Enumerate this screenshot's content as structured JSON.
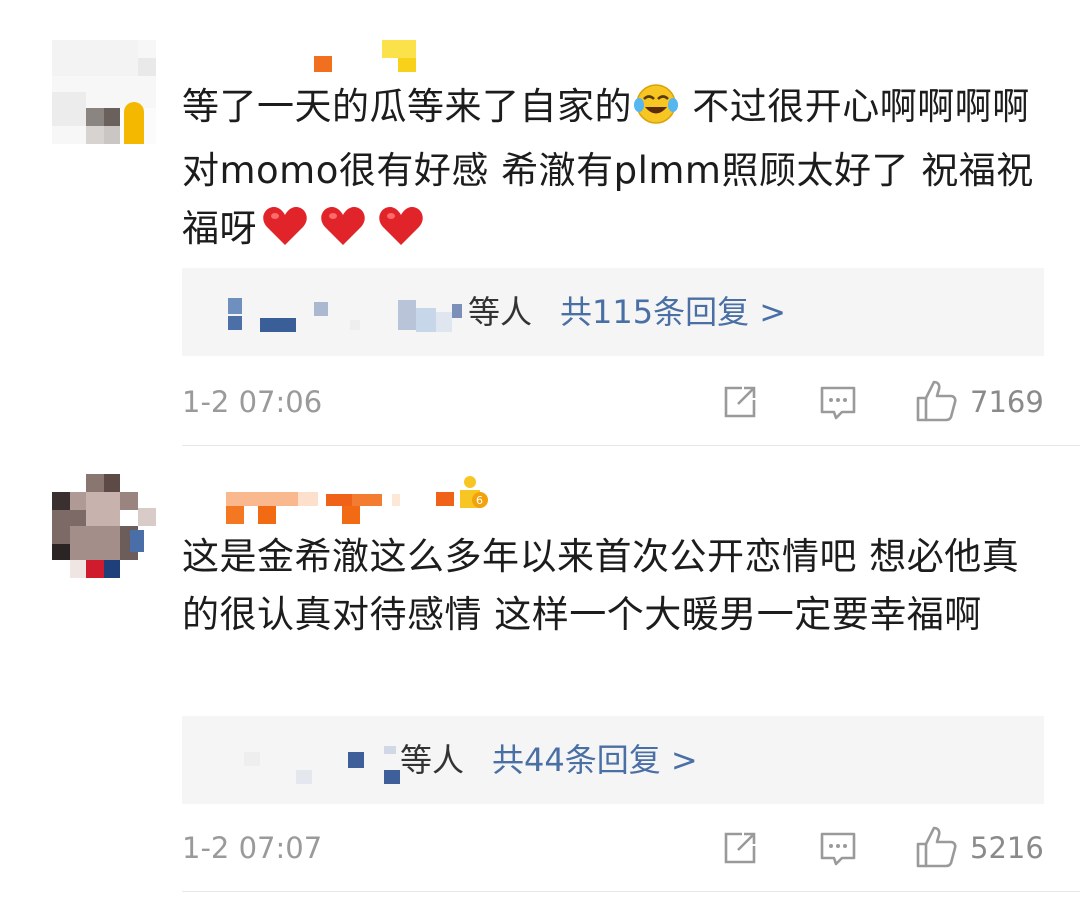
{
  "comments": [
    {
      "text_main": "等了一天的瓜等来了自家的",
      "text_after_emoji": " 不过很开心啊啊啊啊 对momo很有好感 希澈有plmm照顾太好了 祝福祝福呀",
      "emoji": "laugh-cry-emoji",
      "hearts": 3,
      "reply_suffix": "等人",
      "reply_count": "共115条回复 >",
      "time": "1-2 07:06",
      "likes": "7169"
    },
    {
      "text_main": "这是金希澈这么多年以来首次公开恋情吧 想必他真的很认真对待感情 这样一个大暖男一定要幸福啊",
      "reply_suffix": "等人",
      "reply_count": "共44条回复 >",
      "time": "1-2 07:07",
      "likes": "5216"
    }
  ],
  "colors": {
    "link": "#4a6fa5",
    "muted": "#9a9a9a",
    "reply_bg": "#f5f5f5",
    "heart": "#e0242a"
  }
}
